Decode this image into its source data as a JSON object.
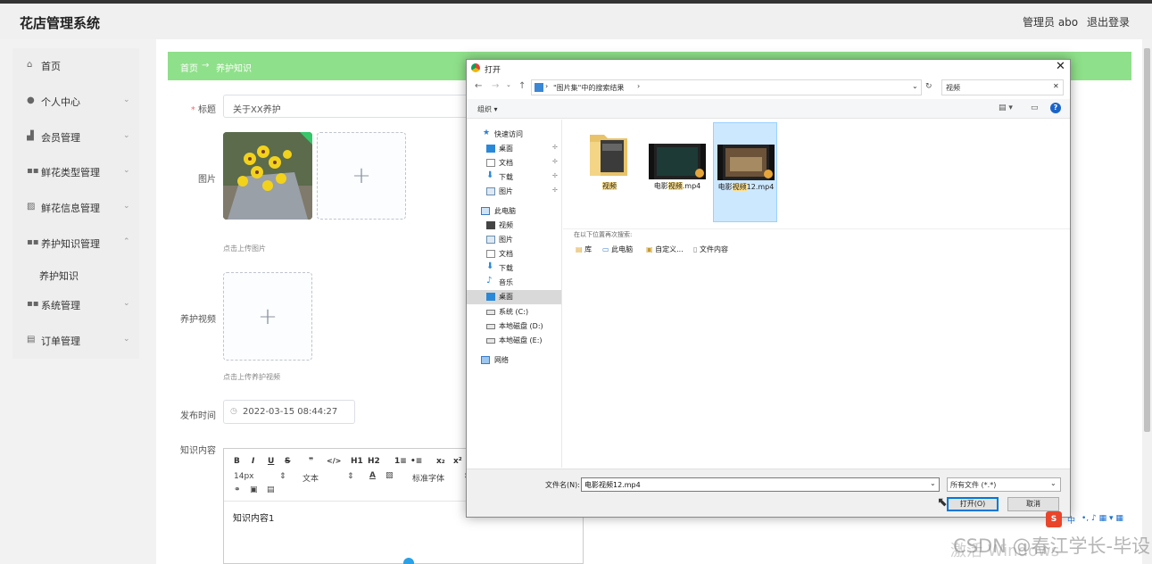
{
  "header": {
    "brand": "花店管理系统",
    "user": "管理员 abo",
    "logout": "退出登录"
  },
  "sidebar": {
    "items": [
      {
        "label": "首页",
        "icon": "home-icon"
      },
      {
        "label": "个人中心",
        "icon": "user-icon"
      },
      {
        "label": "会员管理",
        "icon": "chart-icon"
      },
      {
        "label": "鲜花类型管理",
        "icon": "grid-icon"
      },
      {
        "label": "鲜花信息管理",
        "icon": "image-icon"
      },
      {
        "label": "养护知识管理",
        "icon": "grid-icon"
      },
      {
        "label": "系统管理",
        "icon": "grid-icon"
      },
      {
        "label": "订单管理",
        "icon": "list-icon"
      }
    ],
    "sub_item": "养护知识"
  },
  "breadcrumb": {
    "home": "首页",
    "arrow": "→",
    "current": "养护知识"
  },
  "form": {
    "title_label": "标题",
    "title_value": "关于XX养护",
    "image_label": "图片",
    "image_hint": "点击上传图片",
    "video_label": "养护视频",
    "video_hint": "点击上传养护视频",
    "date_label": "发布时间",
    "date_value": "2022-03-15 08:44:27",
    "content_label": "知识内容",
    "content_value": "知识内容1",
    "toolbar": {
      "bold": "B",
      "italic": "I",
      "underline": "U",
      "strike": "S",
      "quote": "❞",
      "code": "</>",
      "h1": "H1",
      "h2": "H2",
      "ol": "1≡",
      "ul": "•≡",
      "sub": "x₂",
      "sup": "x²",
      "size": "14px",
      "text": "文本",
      "font": "标准字体"
    }
  },
  "dialog": {
    "title": "打开",
    "address": "\"图片集\"中的搜索结果",
    "search": "视频",
    "organize": "组织 ▾",
    "nav": {
      "quick_access": "快速访问",
      "quick": [
        "桌面",
        "文档",
        "下载",
        "图片"
      ],
      "this_pc": "此电脑",
      "pc": [
        "视频",
        "图片",
        "文档",
        "下载",
        "音乐",
        "桌面",
        "系统 (C:)",
        "本地磁盘 (D:)",
        "本地磁盘 (E:)"
      ],
      "network": "网络"
    },
    "files": [
      {
        "pre": "",
        "hl": "视频",
        "post": ""
      },
      {
        "pre": "电影",
        "hl": "视频",
        "post": ".mp4"
      },
      {
        "pre": "电影",
        "hl": "视频",
        "post": "12.mp4"
      }
    ],
    "search_again": "在以下位置再次搜索:",
    "search_locations": [
      "库",
      "此电脑",
      "自定义...",
      "文件内容"
    ],
    "filename_label": "文件名(N):",
    "filename_value": "电影视频12.mp4",
    "filetype": "所有文件 (*.*)",
    "open_btn": "打开(O)",
    "cancel_btn": "取消"
  },
  "tray": {
    "ime": "中",
    "symbols": "•, ♪ ▦ ▾ ▦"
  },
  "watermark": "激活 Windows",
  "csdn": "CSDN @春江学长-毕设",
  "colors": {
    "breadcrumb": "#8fe08a",
    "selected": "#cce8ff",
    "highlight": "#ffe08a"
  }
}
